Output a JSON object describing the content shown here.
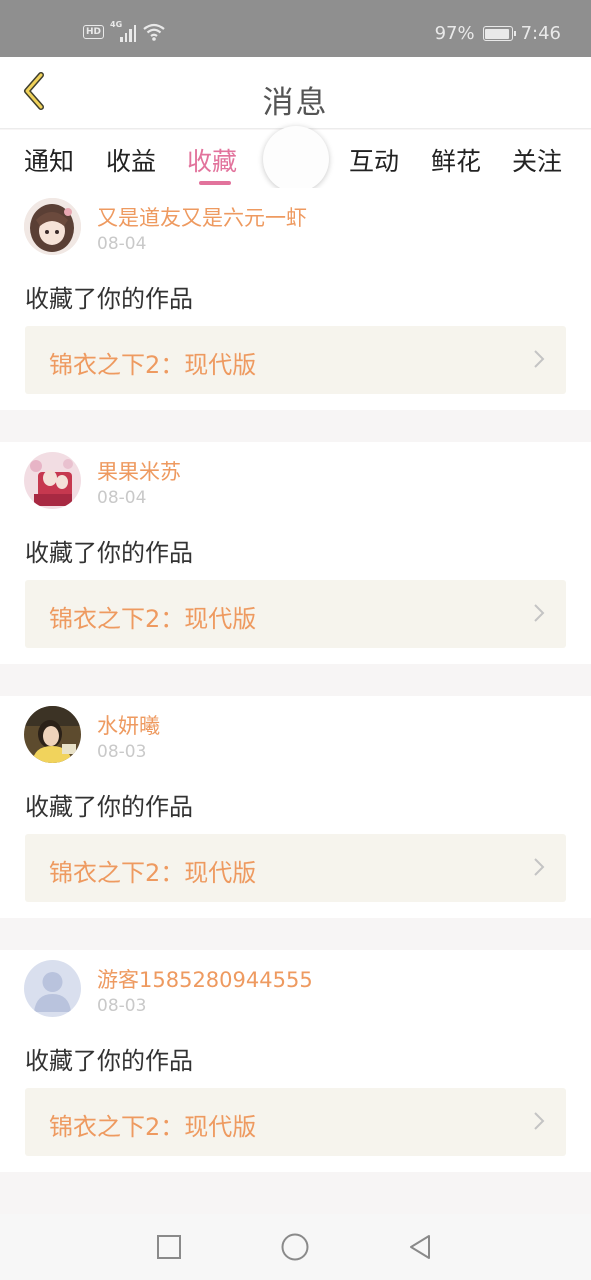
{
  "status_bar": {
    "hd": "HD",
    "network": "4G",
    "battery_percent": "97%",
    "battery_level": 0.97,
    "time": "7:46"
  },
  "header": {
    "title": "消息",
    "back_icon": "chevron-left-icon"
  },
  "tabs": [
    {
      "label": "通知",
      "active": false
    },
    {
      "label": "收益",
      "active": false
    },
    {
      "label": "收藏",
      "active": true
    },
    {
      "label": "互动",
      "active": false
    },
    {
      "label": "鲜花",
      "active": false
    },
    {
      "label": "关注",
      "active": false
    }
  ],
  "colors": {
    "accent": "#e2739c",
    "username": "#ee9a60",
    "work_box_bg": "#f6f4ed"
  },
  "items": [
    {
      "user": "又是道友又是六元一虾",
      "date": "08-04",
      "action": "收藏了你的作品",
      "work": "锦衣之下2：现代版",
      "avatar": "anime-girl-avatar"
    },
    {
      "user": "果果米苏",
      "date": "08-04",
      "action": "收藏了你的作品",
      "work": "锦衣之下2：现代版",
      "avatar": "anime-couple-avatar"
    },
    {
      "user": "水妍曦",
      "date": "08-03",
      "action": "收藏了你的作品",
      "work": "锦衣之下2：现代版",
      "avatar": "photo-girl-avatar"
    },
    {
      "user": "游客1585280944555",
      "date": "08-03",
      "action": "收藏了你的作品",
      "work": "锦衣之下2：现代版",
      "avatar": "default-user-avatar"
    }
  ],
  "nav": {
    "recents_icon": "square-icon",
    "home_icon": "circle-icon",
    "back_icon": "triangle-back-icon"
  }
}
